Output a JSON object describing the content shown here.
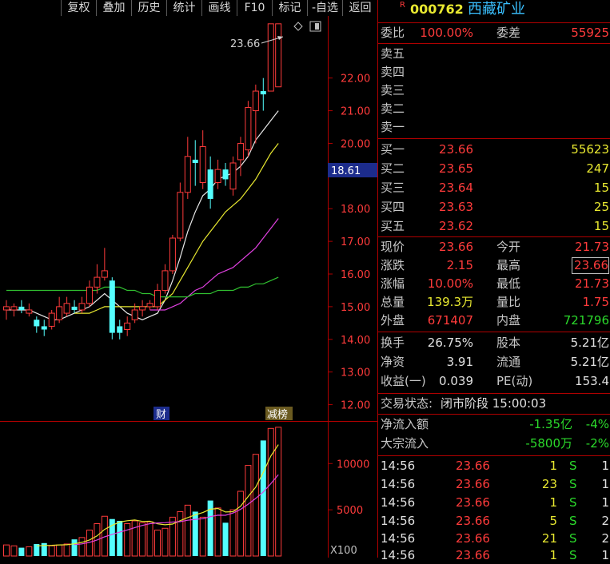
{
  "toolbar": {
    "items": [
      "复权",
      "叠加",
      "历史",
      "统计",
      "画线",
      "F10",
      "标记",
      "-自选",
      "返回"
    ]
  },
  "stock": {
    "badge": "R",
    "code": "000762",
    "name": "西藏矿业"
  },
  "weibi": {
    "label1": "委比",
    "value1": "100.00%",
    "label2": "委差",
    "value2": "55925"
  },
  "sell": [
    {
      "label": "卖五"
    },
    {
      "label": "卖四"
    },
    {
      "label": "卖三"
    },
    {
      "label": "卖二"
    },
    {
      "label": "卖一"
    }
  ],
  "buy": [
    {
      "label": "买一",
      "price": "23.66",
      "vol": "55623"
    },
    {
      "label": "买二",
      "price": "23.65",
      "vol": "247"
    },
    {
      "label": "买三",
      "price": "23.64",
      "vol": "15"
    },
    {
      "label": "买四",
      "price": "23.63",
      "vol": "25"
    },
    {
      "label": "买五",
      "price": "23.62",
      "vol": "15"
    }
  ],
  "quote": [
    {
      "l1": "现价",
      "v1": "23.66",
      "l2": "今开",
      "v2": "21.73"
    },
    {
      "l1": "涨跌",
      "v1": "2.15",
      "l2": "最高",
      "v2": "23.66"
    },
    {
      "l1": "涨幅",
      "v1": "10.00%",
      "l2": "最低",
      "v2": "21.73"
    },
    {
      "l1": "总量",
      "v1": "139.3万",
      "l2": "量比",
      "v2": "1.75"
    },
    {
      "l1": "外盘",
      "v1": "671407",
      "l2": "内盘",
      "v2": "721796"
    }
  ],
  "fundamentals": [
    {
      "l1": "换手",
      "v1": "26.75%",
      "l2": "股本",
      "v2": "5.21亿"
    },
    {
      "l1": "净资",
      "v1": "3.91",
      "l2": "流通",
      "v2": "5.21亿"
    },
    {
      "l1": "收益(一)",
      "v1": "0.039",
      "l2": "PE(动)",
      "v2": "153.4"
    }
  ],
  "status": {
    "label": "交易状态:",
    "value": "闭市阶段 15:00:03"
  },
  "flows": [
    {
      "label": "净流入额",
      "value": "-1.35亿",
      "pct": "-4%"
    },
    {
      "label": "大宗流入",
      "value": "-5800万",
      "pct": "-2%"
    }
  ],
  "ticks": [
    {
      "time": "14:56",
      "price": "23.66",
      "vol": "1",
      "side": "S",
      "n": "1"
    },
    {
      "time": "14:56",
      "price": "23.66",
      "vol": "23",
      "side": "S",
      "n": "1"
    },
    {
      "time": "14:56",
      "price": "23.66",
      "vol": "1",
      "side": "S",
      "n": "1"
    },
    {
      "time": "14:56",
      "price": "23.66",
      "vol": "5",
      "side": "S",
      "n": "2"
    },
    {
      "time": "14:56",
      "price": "23.66",
      "vol": "21",
      "side": "S",
      "n": "2"
    },
    {
      "time": "14:56",
      "price": "23.66",
      "vol": "1",
      "side": "S",
      "n": "1"
    }
  ],
  "chart_data": [
    {
      "type": "candlestick",
      "y_ticks": [
        "22.00",
        "21.00",
        "20.00",
        "18.00",
        "17.00",
        "16.00",
        "15.00",
        "14.00",
        "13.00",
        "12.00"
      ],
      "ylim": [
        11.5,
        23.9
      ],
      "current_price_label": "18.61",
      "max_annotation": "23.66",
      "markers": [
        "财",
        "减榜"
      ],
      "candles": [
        {
          "o": 14.9,
          "c": 15.0,
          "h": 15.2,
          "l": 14.6
        },
        {
          "o": 14.9,
          "c": 15.0,
          "h": 15.1,
          "l": 14.7
        },
        {
          "o": 15.0,
          "c": 14.9,
          "h": 15.2,
          "l": 14.8
        },
        {
          "o": 14.8,
          "c": 14.9,
          "h": 15.1,
          "l": 14.7
        },
        {
          "o": 14.6,
          "c": 14.4,
          "h": 14.7,
          "l": 14.2
        },
        {
          "o": 14.4,
          "c": 14.3,
          "h": 14.6,
          "l": 14.1
        },
        {
          "o": 14.4,
          "c": 14.8,
          "h": 14.9,
          "l": 14.3
        },
        {
          "o": 14.6,
          "c": 15.0,
          "h": 15.3,
          "l": 14.5
        },
        {
          "o": 14.8,
          "c": 15.1,
          "h": 15.3,
          "l": 14.7
        },
        {
          "o": 15.0,
          "c": 14.9,
          "h": 15.2,
          "l": 14.8
        },
        {
          "o": 14.9,
          "c": 15.1,
          "h": 15.3,
          "l": 14.8
        },
        {
          "o": 15.1,
          "c": 15.6,
          "h": 15.8,
          "l": 15.0
        },
        {
          "o": 15.6,
          "c": 15.9,
          "h": 16.3,
          "l": 15.4
        },
        {
          "o": 15.9,
          "c": 16.1,
          "h": 16.8,
          "l": 15.8
        },
        {
          "o": 15.8,
          "c": 14.2,
          "h": 15.9,
          "l": 14.0
        },
        {
          "o": 14.4,
          "c": 14.2,
          "h": 14.6,
          "l": 14.0
        },
        {
          "o": 14.3,
          "c": 14.5,
          "h": 14.7,
          "l": 14.1
        },
        {
          "o": 14.6,
          "c": 14.9,
          "h": 15.1,
          "l": 14.5
        },
        {
          "o": 14.9,
          "c": 15.0,
          "h": 15.2,
          "l": 14.7
        },
        {
          "o": 15.0,
          "c": 15.1,
          "h": 15.2,
          "l": 14.9
        },
        {
          "o": 15.0,
          "c": 15.5,
          "h": 15.7,
          "l": 14.9
        },
        {
          "o": 15.5,
          "c": 16.1,
          "h": 16.3,
          "l": 15.4
        },
        {
          "o": 16.1,
          "c": 17.1,
          "h": 17.2,
          "l": 16.0
        },
        {
          "o": 17.1,
          "c": 18.5,
          "h": 18.8,
          "l": 17.0
        },
        {
          "o": 18.5,
          "c": 19.6,
          "h": 20.2,
          "l": 18.3
        },
        {
          "o": 19.5,
          "c": 19.4,
          "h": 20.1,
          "l": 18.7
        },
        {
          "o": 18.8,
          "c": 19.9,
          "h": 20.4,
          "l": 18.6
        },
        {
          "o": 19.2,
          "c": 18.3,
          "h": 19.6,
          "l": 18.0
        },
        {
          "o": 18.8,
          "c": 19.2,
          "h": 19.5,
          "l": 18.6
        },
        {
          "o": 19.2,
          "c": 18.9,
          "h": 19.4,
          "l": 18.7
        },
        {
          "o": 18.6,
          "c": 19.4,
          "h": 19.6,
          "l": 18.4
        },
        {
          "o": 19.5,
          "c": 20.0,
          "h": 20.2,
          "l": 19.0
        },
        {
          "o": 19.8,
          "c": 21.1,
          "h": 21.3,
          "l": 19.6
        },
        {
          "o": 21.0,
          "c": 21.6,
          "h": 21.8,
          "l": 20.0
        },
        {
          "o": 21.6,
          "c": 21.5,
          "h": 22.0,
          "l": 21.0
        },
        {
          "o": 21.6,
          "c": 23.66,
          "h": 23.66,
          "l": 21.6
        },
        {
          "o": 21.73,
          "c": 23.66,
          "h": 23.66,
          "l": 21.73
        }
      ],
      "ma": [
        {
          "color": "#e8e8e8",
          "values": [
            14.9,
            14.9,
            14.9,
            14.9,
            14.8,
            14.7,
            14.6,
            14.6,
            14.7,
            14.8,
            14.9,
            15.0,
            15.2,
            15.4,
            15.2,
            15.0,
            14.8,
            14.7,
            14.6,
            14.7,
            14.8,
            15.2,
            15.8,
            16.5,
            17.3,
            17.9,
            18.4,
            18.6,
            18.9,
            19.0,
            19.1,
            19.3,
            19.6,
            20.1,
            20.4,
            20.7,
            21.0
          ]
        },
        {
          "color": "#e8e830",
          "values": [
            null,
            null,
            null,
            null,
            null,
            null,
            null,
            null,
            null,
            14.8,
            14.8,
            14.8,
            14.9,
            15.0,
            15.0,
            15.0,
            15.0,
            15.0,
            15.0,
            15.0,
            15.0,
            15.2,
            15.4,
            15.8,
            16.2,
            16.6,
            17.0,
            17.3,
            17.6,
            17.9,
            18.1,
            18.3,
            18.6,
            18.9,
            19.3,
            19.7,
            20.0
          ]
        },
        {
          "color": "#e040e0",
          "values": [
            null,
            null,
            null,
            null,
            null,
            null,
            null,
            null,
            null,
            null,
            null,
            null,
            null,
            null,
            null,
            null,
            null,
            null,
            null,
            14.9,
            14.9,
            14.9,
            15.0,
            15.1,
            15.3,
            15.5,
            15.6,
            15.8,
            16.0,
            16.1,
            16.2,
            16.4,
            16.6,
            16.8,
            17.1,
            17.4,
            17.7
          ]
        },
        {
          "color": "#30c030",
          "values": [
            15.5,
            15.5,
            15.5,
            15.5,
            15.5,
            15.5,
            15.5,
            15.5,
            15.5,
            15.5,
            15.5,
            15.5,
            15.5,
            15.6,
            15.6,
            15.6,
            15.5,
            15.5,
            15.4,
            15.4,
            15.3,
            15.3,
            15.3,
            15.3,
            15.3,
            15.4,
            15.4,
            15.4,
            15.5,
            15.5,
            15.5,
            15.6,
            15.6,
            15.7,
            15.7,
            15.8,
            15.9
          ]
        }
      ]
    },
    {
      "type": "bar",
      "y_ticks": [
        "10000",
        "5000"
      ],
      "unit_label": "X100",
      "ylim": [
        0,
        14000
      ],
      "values": [
        1200,
        1100,
        900,
        1000,
        1300,
        1400,
        1100,
        1200,
        1300,
        1800,
        2000,
        2800,
        3500,
        4300,
        4000,
        3800,
        3500,
        3800,
        3600,
        3700,
        2800,
        3000,
        4200,
        4800,
        5500,
        4800,
        4200,
        6000,
        5200,
        3600,
        5000,
        7000,
        9800,
        11000,
        12500,
        13800,
        13930
      ],
      "up": [
        true,
        true,
        false,
        true,
        false,
        false,
        true,
        true,
        true,
        false,
        true,
        true,
        true,
        true,
        false,
        false,
        true,
        true,
        true,
        true,
        true,
        true,
        true,
        true,
        true,
        false,
        true,
        false,
        true,
        false,
        true,
        true,
        true,
        true,
        false,
        true,
        true
      ],
      "ma": [
        {
          "color": "#e8e830",
          "values": [
            null,
            null,
            null,
            null,
            1100,
            1140,
            1160,
            1200,
            1220,
            1320,
            1480,
            1740,
            2180,
            2880,
            3320,
            3680,
            3820,
            3900,
            3740,
            3760,
            3480,
            3380,
            3460,
            3820,
            4160,
            4460,
            4700,
            5060,
            5140,
            4760,
            4800,
            5380,
            6440,
            7440,
            9060,
            10820,
            12046
          ]
        },
        {
          "color": "#e040e0",
          "values": [
            null,
            null,
            null,
            null,
            null,
            null,
            null,
            null,
            null,
            1230,
            1310,
            1480,
            1740,
            2070,
            2340,
            2580,
            2820,
            3080,
            3310,
            3500,
            3580,
            3600,
            3670,
            3720,
            3870,
            3970,
            4040,
            4260,
            4420,
            4410,
            4650,
            5050,
            5610,
            6230,
            6930,
            7830,
            8800
          ]
        }
      ]
    }
  ]
}
